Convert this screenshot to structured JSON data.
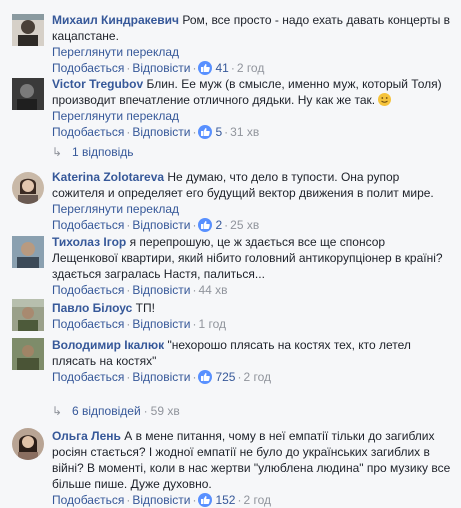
{
  "comments": [
    {
      "author": "Михаил Киндракевич",
      "text": "Ром, все просто - надо ехать давать концерты в кацапстане.",
      "translate": "Переглянути переклад",
      "like": "Подобається",
      "reply": "Відповісти",
      "likes": "41",
      "time": "2 год"
    },
    {
      "author": "Victor Tregubov",
      "text": "Блин. Ее муж (в смысле, именно муж, который Толя) производит впечатление отличного дядьки. Ну как же так.",
      "translate": "Переглянути переклад",
      "like": "Подобається",
      "reply": "Відповісти",
      "likes": "5",
      "time": "31 хв",
      "replies": "1 відповідь"
    },
    {
      "author": "Katerina Zolotareva",
      "text": "Не думаю, что дело в тупости. Она рупор сожителя и определяет его будущий вектор движения в полит мире.",
      "translate": "Переглянути переклад",
      "like": "Подобається",
      "reply": "Відповісти",
      "likes": "2",
      "time": "25 хв"
    },
    {
      "author": "Тихолаз Ігор",
      "text": "я перепрошую, це ж здається все ще спонсор Лещенкової квартири, який нібито головний антикорупціонер в країні? здається загралась Настя, палиться...",
      "like": "Подобається",
      "reply": "Відповісти",
      "time": "44 хв"
    },
    {
      "author": "Павло Білоус",
      "text": "ТП!",
      "like": "Подобається",
      "reply": "Відповісти",
      "time": "1 год"
    },
    {
      "author": "Володимир Ікалюк",
      "text": "\"нехорошо плясать на костях тех, кто летел плясать на костях\"",
      "like": "Подобається",
      "reply": "Відповісти",
      "likes": "725",
      "time": "2 год",
      "replies": "6 відповідей",
      "replies_time": "59 хв"
    },
    {
      "author": "Ольга Лень",
      "text": "А в мене питання, чому в неї емпатії тільки до загиблих росіян стається? І жодної емпатії не було до українських загиблих в війні? В моменті, коли в нас жертви \"улюблена людина\" про музику все більше пише. Дуже духовно.",
      "like": "Подобається",
      "reply": "Відповісти",
      "likes": "152",
      "time": "2 год"
    }
  ],
  "colors": {
    "link": "#365899",
    "meta": "#90949c",
    "like_blue": "#5890ff",
    "bg": "#f6f7f9"
  }
}
